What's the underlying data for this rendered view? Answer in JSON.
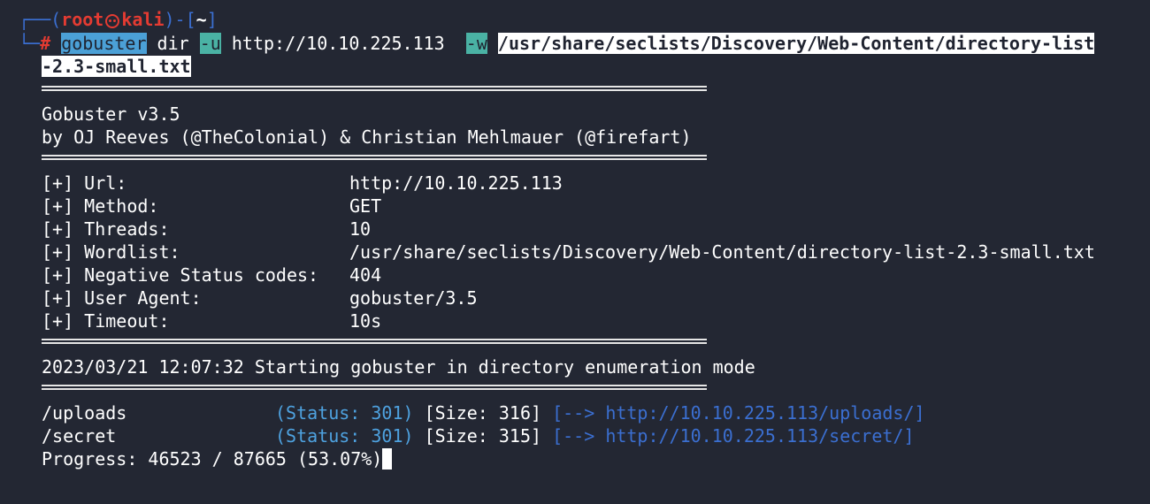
{
  "prompt": {
    "top_left": "┌──(",
    "user": "root",
    "host": "kali",
    "dir_open": ")-[",
    "dir": "~",
    "dir_close": "]",
    "bottom_left": "└─",
    "hash": "#"
  },
  "command": {
    "binary": "gobuster",
    "arg1": " dir ",
    "flag_u": "-u",
    "url": " http://10.10.225.113  ",
    "flag_w": "-w",
    "space": " ",
    "wordlist_part1": "/usr/share/seclists/Discovery/Web-Content/directory-list",
    "wordlist_part2": "-2.3-small.txt"
  },
  "banner": {
    "title": "Gobuster v3.5",
    "authors": "by OJ Reeves (@TheColonial) & Christian Mehlmauer (@firefart)"
  },
  "config": [
    {
      "prefix": "[+]",
      "key": "Url:",
      "value": "http://10.10.225.113"
    },
    {
      "prefix": "[+]",
      "key": "Method:",
      "value": "GET"
    },
    {
      "prefix": "[+]",
      "key": "Threads:",
      "value": "10"
    },
    {
      "prefix": "[+]",
      "key": "Wordlist:",
      "value": "/usr/share/seclists/Discovery/Web-Content/directory-list-2.3-small.txt"
    },
    {
      "prefix": "[+]",
      "key": "Negative Status codes:",
      "value": "404"
    },
    {
      "prefix": "[+]",
      "key": "User Agent:",
      "value": "gobuster/3.5"
    },
    {
      "prefix": "[+]",
      "key": "Timeout:",
      "value": "10s"
    }
  ],
  "start_message": "2023/03/21 12:07:32 Starting gobuster in directory enumeration mode",
  "results": [
    {
      "path": "/uploads",
      "status": "(Status: 301)",
      "size": "[Size: 316]",
      "redirect_open": "[",
      "arrow": "-->",
      "redirect_url": "http://10.10.225.113/uploads/",
      "redirect_close": "]"
    },
    {
      "path": "/secret",
      "status": "(Status: 301)",
      "size": "[Size: 315]",
      "redirect_open": "[",
      "arrow": "-->",
      "redirect_url": "http://10.10.225.113/secret/",
      "redirect_close": "]"
    }
  ],
  "progress": {
    "text": "Progress: 46523 / 87665 (53.07%)",
    "done": 46523,
    "total": 87665,
    "percent": 53.07
  },
  "colors": {
    "background": "#232733",
    "prompt_blue": "#3b6fd1",
    "prompt_red": "#e43b32",
    "status_blue": "#4ea2e0",
    "cmd_highlight": "#4ba0d6",
    "flag_highlight": "#4ab2a4"
  }
}
